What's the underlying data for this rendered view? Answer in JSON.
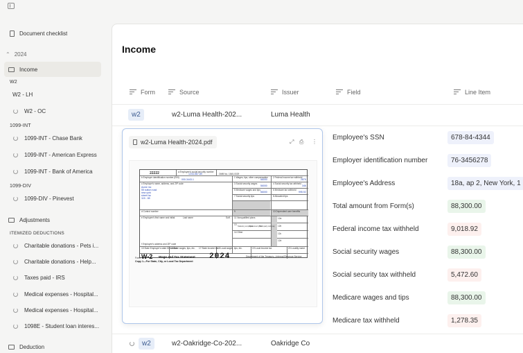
{
  "sidebar": {
    "checklist": "Document checklist",
    "year": "2024",
    "income": "Income",
    "w2_head": "W2",
    "w2_items": [
      "W2 - LH",
      "W2 - OC"
    ],
    "int_head": "1099-INT",
    "int_items": [
      "1099-INT - Chase Bank",
      "1099-INT - American Express",
      "1099-INT - Bank of America"
    ],
    "div_head": "1099-DIV",
    "div_items": [
      "1099-DIV - Pinevest"
    ],
    "adjustments": "Adjustments",
    "itemized_head": "ITEMIZED DEDUCTIONS",
    "itemized_items": [
      "Charitable donations - Pets i...",
      "Charitable donations - Help...",
      "Taxes paid - IRS",
      "Medical expenses - Hospital...",
      "Medical expenses - Hospital...",
      "1098E - Student loan interes..."
    ],
    "deduction": "Deduction"
  },
  "main": {
    "title": "Income",
    "columns": {
      "form": "Form",
      "source": "Source",
      "issuer": "Issuer",
      "field": "Field",
      "line_item": "Line Item"
    },
    "row1": {
      "form": "w2",
      "source": "w2-Luma Health-202...",
      "issuer": "Luma Health"
    },
    "row2": {
      "form": "w2",
      "source": "w2-Oakridge-Co-202...",
      "issuer": "Oakridge Co"
    },
    "fields": [
      {
        "label": "Employee's SSN",
        "value": "678-84-4344",
        "tone": "blue"
      },
      {
        "label": "Employer identification number",
        "value": "76-3456278",
        "tone": "blue"
      },
      {
        "label": "Employee's Address",
        "value": "18a, ap 2, New York, 1",
        "tone": "blue"
      },
      {
        "label": "Total amount from Form(s)",
        "value": "88,300.00",
        "tone": "green"
      },
      {
        "label": "Federal income tax withheld",
        "value": "9,018.92",
        "tone": "red"
      },
      {
        "label": "Social security wages",
        "value": "88,300.00",
        "tone": "green"
      },
      {
        "label": "Social security tax withheld",
        "value": "5,472.60",
        "tone": "red"
      },
      {
        "label": "Medicare wages and tips",
        "value": "88,300.00",
        "tone": "green"
      },
      {
        "label": "Medicare tax withheld",
        "value": "1,278.35",
        "tone": "red"
      }
    ]
  },
  "preview": {
    "filename": "w2-Luma Health-2024.pdf",
    "form": {
      "code": "22222",
      "b1": "a  Employee's social security number",
      "ssn": "1234-567-89",
      "omb": "OMB No. 1545-0029",
      "ein_label": "b  Employer identification number (EIN)",
      "ein": "000-3443-1",
      "box1": "1  Wages, tips, other compensation",
      "box1v": "56000",
      "box2": "2  Federal income tax withheld",
      "box2v": "2875",
      "emp_label": "c  Employer's name, address, and ZIP code",
      "emp_lines": [
        "Acme inc",
        "55 sutton road",
        "new york",
        "street ha",
        "115 - 65"
      ],
      "box3": "3  Social security wages",
      "box3v": "56000",
      "box4": "4  Social security tax withheld",
      "box4v": "346",
      "box5": "5  Medicare wages and tips",
      "box5v": "56000",
      "box6": "6  Medicare tax withheld",
      "box6v": "995.92",
      "box7": "7  Social security tips",
      "box8": "8  Allocated tips",
      "d_label": "d  Control number",
      "box9": "9",
      "box10": "10  Dependent care benefits",
      "e_label": "e  Employee's first name and initial",
      "last": "Last name",
      "suff": "Suff.",
      "box11": "11  Nonqualified plans",
      "box12a": "12a",
      "box12b": "12b",
      "box12c": "12c",
      "box12d": "12d",
      "box13": "13",
      "statutory": "Statutory employee",
      "retirement": "Retirement plan",
      "thirdparty": "Third-party sick pay",
      "box14": "14  Other",
      "f_label": "f  Employee's address and ZIP code",
      "box15": "15  State   Employer's state ID number",
      "box16": "16  State wages, tips, etc.",
      "box17": "17  State income tax",
      "box18": "18  Local wages, tips, etc.",
      "box19": "19  Local income tax",
      "box20": "20  Locality name",
      "form_label": "Form",
      "w2": "W-2",
      "caption": "Wage and Tax Statement",
      "year": "2024",
      "dept": "Department of the Treasury—Internal Revenue Service",
      "copy": "Copy 1—For State, City, or Local Tax Department"
    }
  },
  "colors": {
    "accent_border": "#aec6ea",
    "tag_bg": "#e6edf8",
    "green_bg": "#e9f5ea",
    "red_bg": "#fdf0ee",
    "blue_bg": "#eef1fb"
  }
}
